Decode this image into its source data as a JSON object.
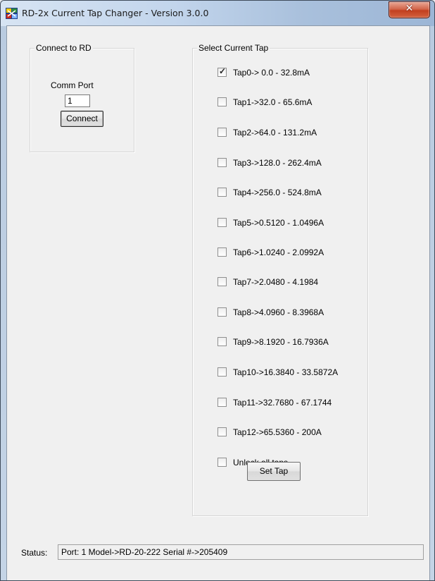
{
  "window": {
    "title": "RD-2x Current Tap Changer - Version 3.0.0",
    "close_label": "✕"
  },
  "connect_group": {
    "label": "Connect to RD",
    "comm_port_label": "Comm Port",
    "comm_port_value": "1",
    "connect_button": "Connect"
  },
  "tap_group": {
    "label": "Select Current Tap",
    "taps": [
      {
        "label": "Tap0-> 0.0 - 32.8mA",
        "checked": true
      },
      {
        "label": "Tap1->32.0 - 65.6mA",
        "checked": false
      },
      {
        "label": "Tap2->64.0 - 131.2mA",
        "checked": false
      },
      {
        "label": "Tap3->128.0 - 262.4mA",
        "checked": false
      },
      {
        "label": "Tap4->256.0 - 524.8mA",
        "checked": false
      },
      {
        "label": "Tap5->0.5120 - 1.0496A",
        "checked": false
      },
      {
        "label": "Tap6->1.0240 - 2.0992A",
        "checked": false
      },
      {
        "label": "Tap7->2.0480 - 4.1984",
        "checked": false
      },
      {
        "label": "Tap8->4.0960 - 8.3968A",
        "checked": false
      },
      {
        "label": "Tap9->8.1920 - 16.7936A",
        "checked": false
      },
      {
        "label": "Tap10->16.3840 - 33.5872A",
        "checked": false
      },
      {
        "label": "Tap11->32.7680 - 67.1744",
        "checked": false
      },
      {
        "label": "Tap12->65.5360 - 200A",
        "checked": false
      }
    ],
    "unlock": {
      "label": "Unlock all taps",
      "checked": false
    },
    "set_tap_button": "Set Tap"
  },
  "status": {
    "label": "Status:",
    "value": "Port: 1   Model->RD-20-222   Serial #->205409"
  }
}
